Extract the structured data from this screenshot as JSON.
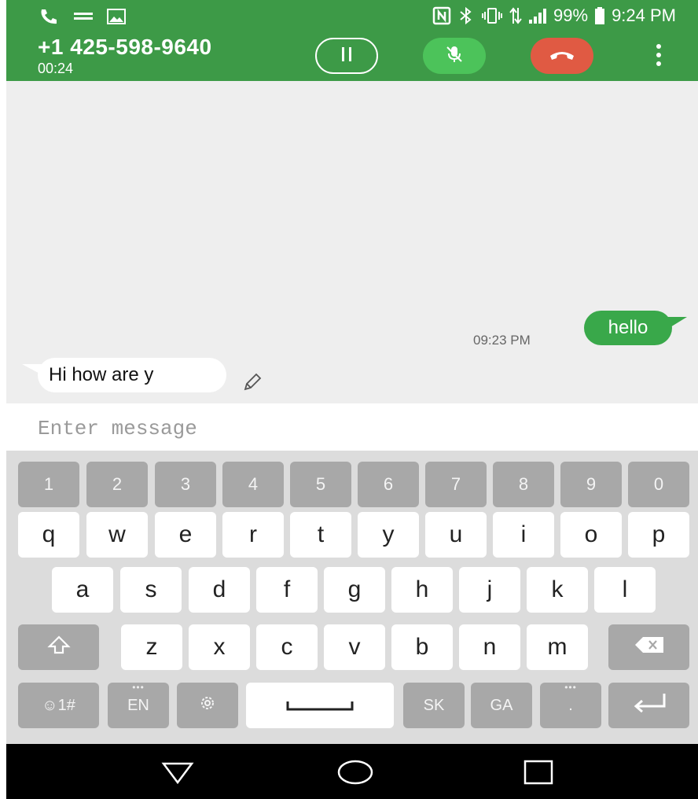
{
  "status_bar": {
    "battery": "99%",
    "time": "9:24 PM",
    "left_icons": [
      "phone-call-icon",
      "voicemail-icon",
      "image-icon"
    ],
    "right_icons": [
      "nfc-icon",
      "bluetooth-icon",
      "vibrate-icon",
      "data-arrows-icon",
      "signal-icon",
      "battery-icon"
    ]
  },
  "call": {
    "number": "+1 425-598-9640",
    "duration": "00:24",
    "colors": {
      "bar": "#3d9a47",
      "mute": "#4cc35a",
      "end": "#e05a43"
    }
  },
  "conversation": {
    "sent": {
      "text": "hello",
      "time": "09:23 PM"
    },
    "received": {
      "text": "Hi how are y"
    }
  },
  "input": {
    "placeholder": "Enter message"
  },
  "keyboard": {
    "number_row": [
      "1",
      "2",
      "3",
      "4",
      "5",
      "6",
      "7",
      "8",
      "9",
      "0"
    ],
    "row1": [
      "q",
      "w",
      "e",
      "r",
      "t",
      "y",
      "u",
      "i",
      "o",
      "p"
    ],
    "row2": [
      "a",
      "s",
      "d",
      "f",
      "g",
      "h",
      "j",
      "k",
      "l"
    ],
    "row3": [
      "z",
      "x",
      "c",
      "v",
      "b",
      "n",
      "m"
    ],
    "bottom": {
      "symbols": "☺1#",
      "lang": "EN",
      "sk": "SK",
      "ga": "GA",
      "period": "."
    }
  },
  "nav": {
    "icons": [
      "back-icon",
      "home-icon",
      "recents-icon"
    ]
  }
}
